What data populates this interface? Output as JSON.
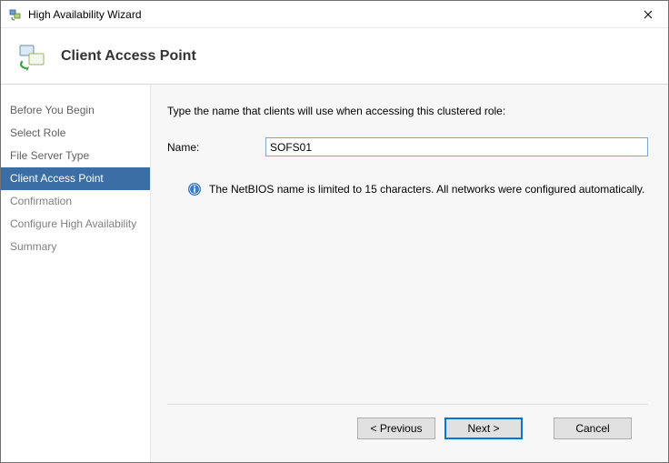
{
  "window": {
    "title": "High Availability Wizard"
  },
  "header": {
    "heading": "Client Access Point"
  },
  "sidebar": {
    "steps": [
      {
        "label": "Before You Begin",
        "state": "done"
      },
      {
        "label": "Select Role",
        "state": "done"
      },
      {
        "label": "File Server Type",
        "state": "done"
      },
      {
        "label": "Client Access Point",
        "state": "active"
      },
      {
        "label": "Confirmation",
        "state": "pending"
      },
      {
        "label": "Configure High Availability",
        "state": "pending"
      },
      {
        "label": "Summary",
        "state": "pending"
      }
    ]
  },
  "content": {
    "instruction": "Type the name that clients will use when accessing this clustered role:",
    "name_label": "Name:",
    "name_value": "SOFS01",
    "info_text": "The NetBIOS name is limited to 15 characters.  All networks were configured automatically."
  },
  "footer": {
    "previous": "< Previous",
    "next": "Next >",
    "cancel": "Cancel"
  }
}
